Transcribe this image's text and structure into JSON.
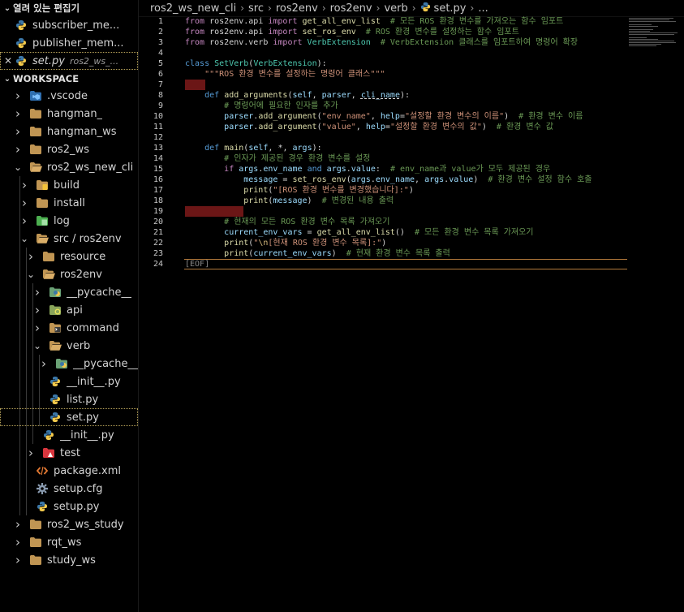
{
  "sidebar": {
    "open_editors_title": "열려 있는 편집기",
    "open_editors": [
      {
        "label": "subscriber_me..."
      },
      {
        "label": "publisher_mem..."
      },
      {
        "label": "set.py",
        "hint": "ros2_ws_..."
      }
    ],
    "workspace_title": "WORKSPACE",
    "tree": [
      {
        "label": ".vscode"
      },
      {
        "label": "hangman_"
      },
      {
        "label": "hangman_ws"
      },
      {
        "label": "ros2_ws"
      },
      {
        "label": "ros2_ws_new_cli"
      },
      {
        "label": "build"
      },
      {
        "label": "install"
      },
      {
        "label": "log"
      },
      {
        "label": "src / ros2env"
      },
      {
        "label": "resource"
      },
      {
        "label": "ros2env"
      },
      {
        "label": "__pycache__"
      },
      {
        "label": "api"
      },
      {
        "label": "command"
      },
      {
        "label": "verb"
      },
      {
        "label": "__pycache__"
      },
      {
        "label": "__init__.py"
      },
      {
        "label": "list.py"
      },
      {
        "label": "set.py"
      },
      {
        "label": "__init__.py"
      },
      {
        "label": "test"
      },
      {
        "label": "package.xml"
      },
      {
        "label": "setup.cfg"
      },
      {
        "label": "setup.py"
      },
      {
        "label": "ros2_ws_study"
      },
      {
        "label": "rqt_ws"
      },
      {
        "label": "study_ws"
      }
    ]
  },
  "breadcrumbs": [
    "ros2_ws_new_cli",
    "src",
    "ros2env",
    "ros2env",
    "verb",
    "set.py",
    "..."
  ],
  "code": {
    "line_numbers": [
      "1",
      "2",
      "3",
      "4",
      "5",
      "6",
      "7",
      "8",
      "9",
      "10",
      "11",
      "12",
      "13",
      "14",
      "15",
      "16",
      "17",
      "18",
      "19",
      "20",
      "21",
      "22",
      "23",
      "24"
    ],
    "l1": [
      "from",
      " ros2env.api ",
      "import",
      " ",
      "get_all_env_list",
      "  # 모든 ROS 환경 변수를 가져오는 함수 임포트"
    ],
    "l2": [
      "from",
      " ros2env.api ",
      "import",
      " ",
      "set_ros_env",
      "  # ROS 환경 변수를 설정하는 함수 임포트"
    ],
    "l3": [
      "from",
      " ros2env.verb ",
      "import",
      " ",
      "VerbExtension",
      "  # VerbExtension 클래스를 임포트하여 명령어 확장"
    ],
    "l5": [
      "class",
      " ",
      "SetVerb",
      "(",
      "VerbExtension",
      "):"
    ],
    "l6": "\"\"\"ROS 환경 변수를 설정하는 명령어 클래스\"\"\"",
    "l8": [
      "def",
      " ",
      "add_arguments",
      "(",
      "self",
      ", ",
      "parser",
      ", ",
      "cli_name",
      "):"
    ],
    "l9": "# 명령어에 필요한 인자를 추가",
    "l10": [
      "parser",
      ".",
      "add_argument",
      "(",
      "\"env_name\"",
      ", ",
      "help",
      "=",
      "\"설정할 환경 변수의 이름\"",
      ")  ",
      "# 환경 변수 이름"
    ],
    "l11": [
      "parser",
      ".",
      "add_argument",
      "(",
      "\"value\"",
      ", ",
      "help",
      "=",
      "\"설정할 환경 변수의 값\"",
      ")  ",
      "# 환경 변수 값"
    ],
    "l13": [
      "def",
      " ",
      "main",
      "(",
      "self",
      ", *, ",
      "args",
      "):"
    ],
    "l14": "# 인자가 제공된 경우 환경 변수를 설정",
    "l15": [
      "if",
      " ",
      "args",
      ".",
      "env_name",
      " ",
      "and",
      " ",
      "args",
      ".",
      "value",
      ":  ",
      "# env_name과 value가 모두 제공된 경우"
    ],
    "l16": [
      "message",
      " = ",
      "set_ros_env",
      "(",
      "args",
      ".",
      "env_name",
      ", ",
      "args",
      ".",
      "value",
      ")  ",
      "# 환경 변수 설정 함수 호출"
    ],
    "l17": [
      "print",
      "(",
      "\"[ROS 환경 변수를 변경했습니다]:\"",
      ")"
    ],
    "l18": [
      "print",
      "(",
      "message",
      ")  ",
      "# 변경된 내용 출력"
    ],
    "l20": "# 현재의 모든 ROS 환경 변수 목록 가져오기",
    "l21": [
      "current_env_vars",
      " = ",
      "get_all_env_list",
      "()  ",
      "# 모든 환경 변수 목록 가져오기"
    ],
    "l22": [
      "print",
      "(",
      "\"",
      "\\n",
      "[현재 ROS 환경 변수 목록]:\"",
      ")"
    ],
    "l23": [
      "print",
      "(",
      "current_env_vars",
      ")  ",
      "# 현재 환경 변수 목록 출력"
    ],
    "l24": "[EOF]"
  }
}
